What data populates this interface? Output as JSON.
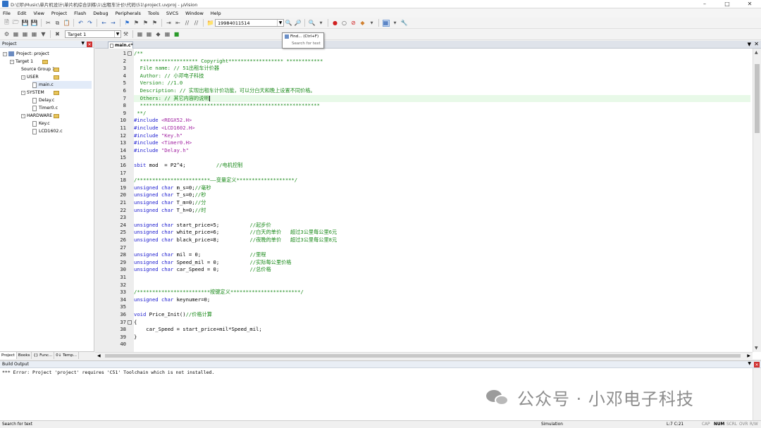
{
  "window": {
    "title": "D:\\[邓\\Music\\单片机设计\\单片机综合训练\\1\\出租车计价\\代码\\51\\project.uvproj - µVision"
  },
  "menu": [
    "File",
    "Edit",
    "View",
    "Project",
    "Flash",
    "Debug",
    "Peripherals",
    "Tools",
    "SVCS",
    "Window",
    "Help"
  ],
  "toolbar": {
    "search_combo_value": "19984011514",
    "target_combo_value": "Target 1"
  },
  "tooltip": {
    "title": "Find... (Ctrl+F)",
    "subtitle": "Search for text"
  },
  "project_panel": {
    "title": "Project",
    "tree": [
      {
        "label": "Project: project",
        "depth": 0,
        "kind": "project"
      },
      {
        "label": "Target 1",
        "depth": 1,
        "kind": "target"
      },
      {
        "label": "Source Group 1",
        "depth": 2,
        "kind": "folder"
      },
      {
        "label": "USER",
        "depth": 2,
        "kind": "folder"
      },
      {
        "label": "main.c",
        "depth": 3,
        "kind": "file",
        "selected": true
      },
      {
        "label": "SYSTEM",
        "depth": 2,
        "kind": "folder"
      },
      {
        "label": "Delay.c",
        "depth": 3,
        "kind": "file"
      },
      {
        "label": "Timer0.c",
        "depth": 3,
        "kind": "file"
      },
      {
        "label": "HARDWARE",
        "depth": 2,
        "kind": "folder"
      },
      {
        "label": "Key.c",
        "depth": 3,
        "kind": "file"
      },
      {
        "label": "LCD1602.c",
        "depth": 3,
        "kind": "file"
      }
    ],
    "tabs": [
      "Project",
      "Books",
      "{} Func...",
      "0↓ Temp..."
    ]
  },
  "editor": {
    "tab_label": "main.c*",
    "cursor_line": 7,
    "lines": [
      {
        "n": 1,
        "fold": "-",
        "segs": [
          [
            "c",
            "/**"
          ]
        ]
      },
      {
        "n": 2,
        "segs": [
          [
            "c",
            "  ******************* Copyright****************** ************"
          ]
        ]
      },
      {
        "n": 3,
        "segs": [
          [
            "c",
            "  File name: // 51出租车计价器"
          ]
        ]
      },
      {
        "n": 4,
        "segs": [
          [
            "c",
            "  Author: // 小邓电子科技"
          ]
        ]
      },
      {
        "n": 5,
        "segs": [
          [
            "c",
            "  Version: //1.0"
          ]
        ]
      },
      {
        "n": 6,
        "segs": [
          [
            "c",
            "  Description: // 实现出租车计价功能，可以分白天和晚上设置不同价格。"
          ]
        ]
      },
      {
        "n": 7,
        "segs": [
          [
            "c",
            "  Others: // 其它内容的说明"
          ]
        ],
        "caret": true
      },
      {
        "n": 8,
        "segs": [
          [
            "c",
            "  ***********************************************************"
          ]
        ]
      },
      {
        "n": 9,
        "segs": [
          [
            "c",
            " **/"
          ]
        ]
      },
      {
        "n": 10,
        "segs": [
          [
            "p",
            "#include "
          ],
          [
            "s",
            "<REGX52.H>"
          ]
        ]
      },
      {
        "n": 11,
        "segs": [
          [
            "p",
            "#include "
          ],
          [
            "s",
            "<LCD1602.H>"
          ]
        ]
      },
      {
        "n": 12,
        "segs": [
          [
            "p",
            "#include "
          ],
          [
            "s",
            "\"Key.h\""
          ]
        ]
      },
      {
        "n": 13,
        "segs": [
          [
            "p",
            "#include "
          ],
          [
            "s",
            "<Timer0.H>"
          ]
        ]
      },
      {
        "n": 14,
        "segs": [
          [
            "p",
            "#include "
          ],
          [
            "s",
            "\"Delay.h\""
          ]
        ]
      },
      {
        "n": 15,
        "segs": []
      },
      {
        "n": 16,
        "segs": [
          [
            "k",
            "sbit"
          ],
          [
            "d",
            " mod  = P2^4;          "
          ],
          [
            "c",
            "//电机控制"
          ]
        ]
      },
      {
        "n": 17,
        "segs": []
      },
      {
        "n": 18,
        "segs": [
          [
            "c",
            "/************************——变量定义*******************/"
          ]
        ]
      },
      {
        "n": 19,
        "segs": [
          [
            "k",
            "unsigned char"
          ],
          [
            "d",
            " m_s=0;"
          ],
          [
            "c",
            "//毫秒"
          ]
        ]
      },
      {
        "n": 20,
        "segs": [
          [
            "k",
            "unsigned char"
          ],
          [
            "d",
            " T_s=0;"
          ],
          [
            "c",
            "//秒"
          ]
        ]
      },
      {
        "n": 21,
        "segs": [
          [
            "k",
            "unsigned char"
          ],
          [
            "d",
            " T_m=0;"
          ],
          [
            "c",
            "//分"
          ]
        ]
      },
      {
        "n": 22,
        "segs": [
          [
            "k",
            "unsigned char"
          ],
          [
            "d",
            " T_h=0;"
          ],
          [
            "c",
            "//时"
          ]
        ]
      },
      {
        "n": 23,
        "segs": []
      },
      {
        "n": 24,
        "segs": [
          [
            "k",
            "unsigned char"
          ],
          [
            "d",
            " start_price=5;          "
          ],
          [
            "c",
            "//起步价"
          ]
        ]
      },
      {
        "n": 25,
        "segs": [
          [
            "k",
            "unsigned char"
          ],
          [
            "d",
            " white_price=6;          "
          ],
          [
            "c",
            "//白天的单价   超过3公里每公里6元"
          ]
        ]
      },
      {
        "n": 26,
        "segs": [
          [
            "k",
            "unsigned char"
          ],
          [
            "d",
            " black_price=8;          "
          ],
          [
            "c",
            "//夜晚的单价   超过3公里每公里8元"
          ]
        ]
      },
      {
        "n": 27,
        "segs": []
      },
      {
        "n": 28,
        "segs": [
          [
            "k",
            "unsigned char"
          ],
          [
            "d",
            " mil = 0;                "
          ],
          [
            "c",
            "//里程"
          ]
        ]
      },
      {
        "n": 29,
        "segs": [
          [
            "k",
            "unsigned char"
          ],
          [
            "d",
            " Speed_mil = 0;          "
          ],
          [
            "c",
            "//实际每公里价格"
          ]
        ]
      },
      {
        "n": 30,
        "segs": [
          [
            "k",
            "unsigned char"
          ],
          [
            "d",
            " car_Speed = 0;          "
          ],
          [
            "c",
            "//总价格"
          ]
        ]
      },
      {
        "n": 31,
        "segs": []
      },
      {
        "n": 32,
        "segs": []
      },
      {
        "n": 33,
        "segs": [
          [
            "c",
            "/************************按键定义***********************/"
          ]
        ]
      },
      {
        "n": 34,
        "segs": [
          [
            "k",
            "unsigned char"
          ],
          [
            "d",
            " keynumer=0;"
          ]
        ]
      },
      {
        "n": 35,
        "segs": []
      },
      {
        "n": 36,
        "segs": [
          [
            "k",
            "void"
          ],
          [
            "d",
            " Price_Init()"
          ],
          [
            "c",
            "//价格计算"
          ]
        ]
      },
      {
        "n": 37,
        "fold": "-",
        "segs": [
          [
            "d",
            "{"
          ]
        ]
      },
      {
        "n": 38,
        "segs": [
          [
            "d",
            "    car_Speed = start_price+mil*Speed_mil;"
          ]
        ]
      },
      {
        "n": 39,
        "segs": [
          [
            "d",
            "}"
          ]
        ]
      },
      {
        "n": 40,
        "segs": []
      }
    ]
  },
  "build_output": {
    "title": "Build Output",
    "message": "*** Error: Project 'project' requires 'C51' Toolchain which is not installed."
  },
  "watermark": {
    "text": "公众号 · 小邓电子科技"
  },
  "statusbar": {
    "left": "Search for text",
    "mode": "Simulation",
    "position": "L:7 C:21",
    "caps": "CAP",
    "num": "NUM",
    "scrl": "SCRL",
    "ovr": "OVR",
    "rw": "R/W"
  },
  "colors": {
    "comment": "#1a8a1a",
    "keyword": "#2020d0",
    "string": "#a020a0",
    "current_line": "#e8f9e8"
  }
}
